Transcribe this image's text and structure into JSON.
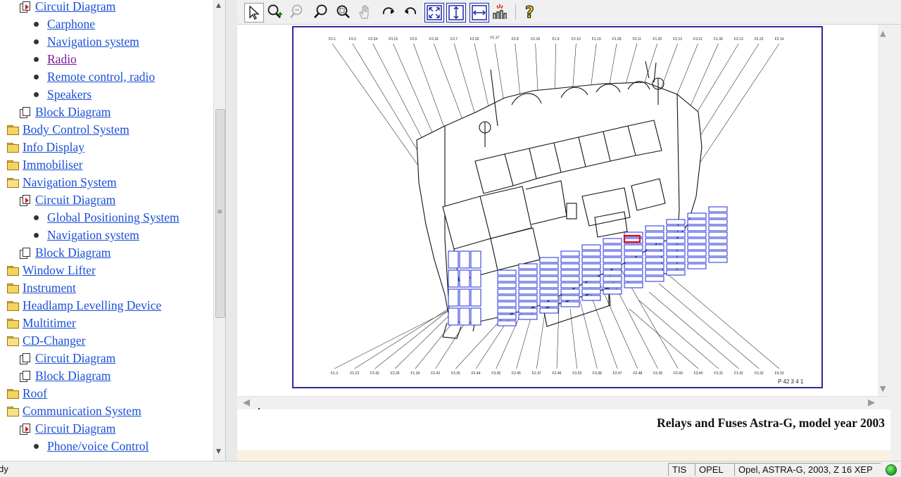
{
  "tree": {
    "items": [
      {
        "label": "Circuit Diagram",
        "icon": "red-pointer-doc-icon",
        "level": 1
      },
      {
        "label": "Carphone",
        "icon": "bullet-icon",
        "level": 2
      },
      {
        "label": "Navigation system",
        "icon": "bullet-icon",
        "level": 2
      },
      {
        "label": "Radio",
        "icon": "bullet-icon",
        "level": 2,
        "visited": true
      },
      {
        "label": "Remote control, radio",
        "icon": "bullet-icon",
        "level": 2
      },
      {
        "label": "Speakers",
        "icon": "bullet-icon",
        "level": 2
      },
      {
        "label": "Block Diagram",
        "icon": "doc-icon",
        "level": 1
      },
      {
        "label": "Body Control System",
        "icon": "folder-icon",
        "level": 0
      },
      {
        "label": "Info Display",
        "icon": "folder-icon",
        "level": 0
      },
      {
        "label": "Immobiliser",
        "icon": "folder-icon",
        "level": 0
      },
      {
        "label": "Navigation System",
        "icon": "open-folder-icon",
        "level": 0
      },
      {
        "label": "Circuit Diagram",
        "icon": "red-pointer-doc-icon",
        "level": 1
      },
      {
        "label": "Global Positioning System",
        "icon": "bullet-icon",
        "level": 2
      },
      {
        "label": "Navigation system",
        "icon": "bullet-icon",
        "level": 2
      },
      {
        "label": "Block Diagram",
        "icon": "doc-icon",
        "level": 1
      },
      {
        "label": "Window Lifter",
        "icon": "folder-icon",
        "level": 0
      },
      {
        "label": "Instrument",
        "icon": "folder-icon",
        "level": 0
      },
      {
        "label": "Headlamp Levelling Device",
        "icon": "folder-icon",
        "level": 0
      },
      {
        "label": "Multitimer",
        "icon": "folder-icon",
        "level": 0
      },
      {
        "label": "CD-Changer",
        "icon": "open-folder-icon",
        "level": 0
      },
      {
        "label": "Circuit Diagram",
        "icon": "doc-icon",
        "level": 1
      },
      {
        "label": "Block Diagram",
        "icon": "doc-icon",
        "level": 1
      },
      {
        "label": "Roof",
        "icon": "folder-icon",
        "level": 0
      },
      {
        "label": "Communication System",
        "icon": "open-folder-icon",
        "level": 0
      },
      {
        "label": "Circuit Diagram",
        "icon": "red-pointer-doc-icon",
        "level": 1
      },
      {
        "label": "Phone/voice Control",
        "icon": "bullet-icon",
        "level": 2
      }
    ]
  },
  "toolbar": {
    "tools": [
      "select-arrow-icon",
      "zoom-in-icon",
      "zoom-out-icon",
      "magnify-icon",
      "zoom-window-icon",
      "pan-hand-icon",
      "rotate-cw-icon",
      "rotate-ccw-icon",
      "fit-all-icon",
      "fit-height-icon",
      "fit-width-icon",
      "highlight-icon",
      "help-icon"
    ]
  },
  "diagram": {
    "top_labels": [
      "F2.1",
      "F3.2",
      "F2.34",
      "F3.15",
      "F2.6",
      "F2.16",
      "F2.7",
      "F2.26",
      "F1.17",
      "F2.8",
      "F2.18",
      "F1.9",
      "F2.10",
      "F1.19",
      "F1.28",
      "F2.11",
      "F1.20",
      "F2.12",
      "F3.21",
      "F1.30",
      "F3.13",
      "F2.22",
      "F2.14"
    ],
    "bottom_labels": [
      "F1.3",
      "F1.23",
      "F2.42",
      "F2.25",
      "F1.34",
      "F2.43",
      "F3.35",
      "F2.44",
      "F3.36",
      "F2.45",
      "F2.37",
      "F2.46",
      "F3.29",
      "F3.38",
      "F2.47",
      "F2.48",
      "F3.39",
      "F2.49",
      "F3.40",
      "F3.31",
      "F1.41",
      "F3.32",
      "F3.33"
    ],
    "figure_id": "P 42 3 4 1",
    "accent_color": "#1f2dd8",
    "highlight_color": "#e01010"
  },
  "caption": {
    "text": "Relays and Fuses Astra-G, model year 2003"
  },
  "statusbar": {
    "status": "dy",
    "cells": [
      "TIS",
      "OPEL",
      "Opel, ASTRA-G, 2003, Z 16 XEP"
    ],
    "indicator_color": "#1a9f1a"
  }
}
